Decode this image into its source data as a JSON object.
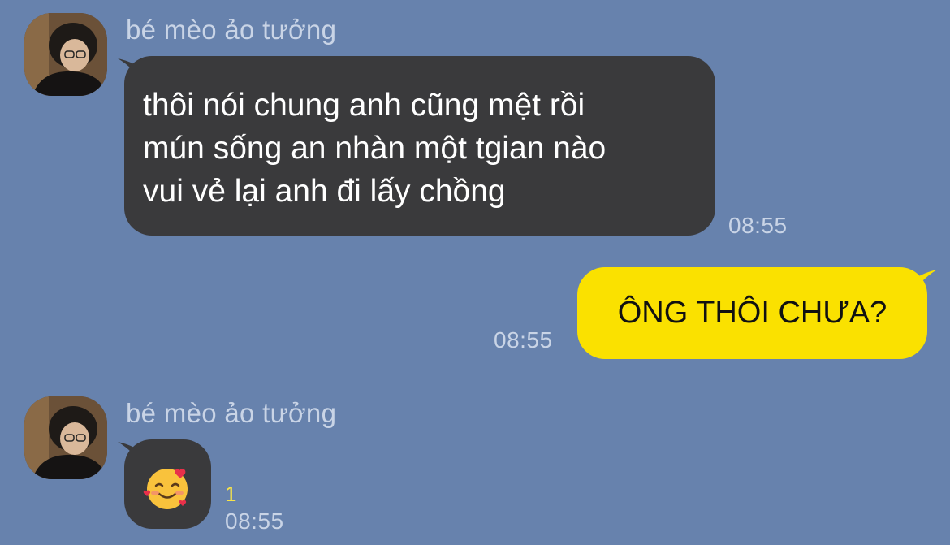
{
  "chat": {
    "messages": [
      {
        "sender": "bé mèo ảo tưởng",
        "lines": [
          "thôi nói chung anh cũng mệt rồi",
          "mún sống an nhàn một tgian nào",
          "vui vẻ lại anh đi lấy chồng"
        ],
        "time": "08:55"
      },
      {
        "text": "ÔNG THÔI CHƯA?",
        "time": "08:55"
      },
      {
        "sender": "bé mèo ảo tưởng",
        "emoji": "smiling-face-with-hearts",
        "unread_count": "1",
        "time": "08:55"
      }
    ]
  },
  "colors": {
    "background": "#6782ad",
    "incoming_bubble": "#3a3a3c",
    "outgoing_bubble": "#fae100",
    "meta_text": "#c9d4e6",
    "unread": "#f7e34a"
  }
}
